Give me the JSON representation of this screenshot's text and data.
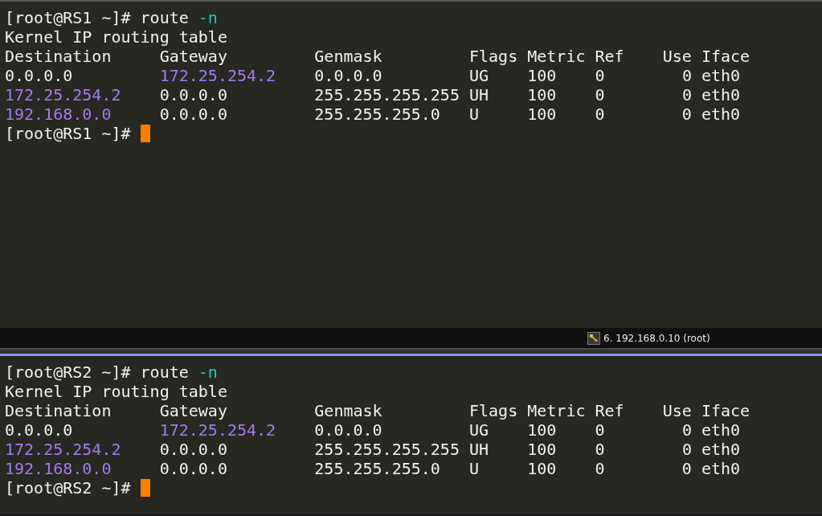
{
  "terminals": [
    {
      "lines": [
        [
          {
            "text": "[root@RS1 ~]# route ",
            "kind": "plain"
          },
          {
            "text": "-n",
            "kind": "option"
          }
        ],
        [
          {
            "text": "Kernel IP routing table",
            "kind": "plain"
          }
        ],
        [
          {
            "text": "Destination     Gateway         Genmask         Flags Metric Ref    Use Iface",
            "kind": "plain"
          }
        ],
        [
          {
            "text": "0.0.0.0         ",
            "kind": "plain"
          },
          {
            "text": "172.25.254.2",
            "kind": "address"
          },
          {
            "text": "    0.0.0.0         UG    100    0        0 eth0",
            "kind": "plain"
          }
        ],
        [
          {
            "text": "172.25.254.2",
            "kind": "address"
          },
          {
            "text": "    0.0.0.0         255.255.255.255 UH    100    0        0 eth0",
            "kind": "plain"
          }
        ],
        [
          {
            "text": "192.168.0.0",
            "kind": "address"
          },
          {
            "text": "     0.0.0.0         255.255.255.0   U     100    0        0 eth0",
            "kind": "plain"
          }
        ],
        [
          {
            "text": "[root@RS1 ~]# ",
            "kind": "plain"
          }
        ]
      ],
      "cursor": true,
      "status": "6. 192.168.0.10 (root)"
    },
    {
      "lines": [
        [
          {
            "text": "[root@RS2 ~]# route ",
            "kind": "plain"
          },
          {
            "text": "-n",
            "kind": "option"
          }
        ],
        [
          {
            "text": "Kernel IP routing table",
            "kind": "plain"
          }
        ],
        [
          {
            "text": "Destination     Gateway         Genmask         Flags Metric Ref    Use Iface",
            "kind": "plain"
          }
        ],
        [
          {
            "text": "0.0.0.0         ",
            "kind": "plain"
          },
          {
            "text": "172.25.254.2",
            "kind": "address"
          },
          {
            "text": "    0.0.0.0         UG    100    0        0 eth0",
            "kind": "plain"
          }
        ],
        [
          {
            "text": "172.25.254.2",
            "kind": "address"
          },
          {
            "text": "    0.0.0.0         255.255.255.255 UH    100    0        0 eth0",
            "kind": "plain"
          }
        ],
        [
          {
            "text": "192.168.0.0",
            "kind": "address"
          },
          {
            "text": "     0.0.0.0         255.255.255.0   U     100    0        0 eth0",
            "kind": "plain"
          }
        ],
        [
          {
            "text": "[root@RS2 ~]# ",
            "kind": "plain"
          }
        ]
      ],
      "cursor": true
    }
  ]
}
